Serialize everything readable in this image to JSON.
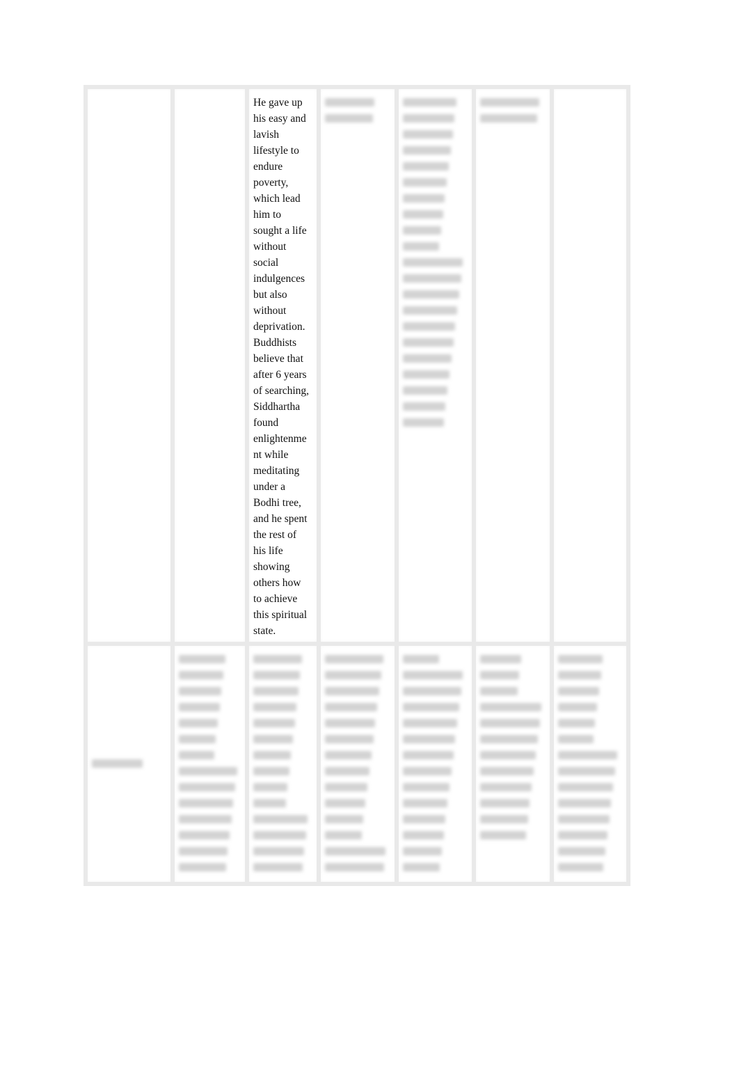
{
  "document": {
    "table": {
      "rows": [
        {
          "cells": [
            {
              "text": "",
              "blurred": false
            },
            {
              "text": "",
              "blurred": false
            },
            {
              "text": "He gave up\nhis easy and\nlavish\nlifestyle to\nendure\npoverty,\nwhich lead\nhim to\nsought a life\nwithout\nsocial\nindulgences\nbut also\nwithout\ndeprivation.\nBuddhists\nbelieve that\nafter 6 years\nof searching,\nSiddhartha\nfound\nenlightenme\nnt while\nmeditating\nunder a\nBodhi tree,\nand he spent\nthe rest of\nhis life\nshowing\nothers how\nto achieve\nthis spiritual\nstate.",
              "blurred": false
            },
            {
              "text": "[blurred]",
              "blurred": true,
              "lines": 2
            },
            {
              "text": "[blurred]",
              "blurred": true,
              "lines": 21
            },
            {
              "text": "[blurred]",
              "blurred": true,
              "lines": 2
            },
            {
              "text": "",
              "blurred": false
            }
          ]
        },
        {
          "cells": [
            {
              "text": "[blurred]",
              "blurred": true,
              "lines": 1
            },
            {
              "text": "[blurred]",
              "blurred": true,
              "lines": 14
            },
            {
              "text": "[blurred]",
              "blurred": true,
              "lines": 14
            },
            {
              "text": "[blurred]",
              "blurred": true,
              "lines": 14
            },
            {
              "text": "[blurred]",
              "blurred": true,
              "lines": 14
            },
            {
              "text": "[blurred]",
              "blurred": true,
              "lines": 12
            },
            {
              "text": "[blurred]",
              "blurred": true,
              "lines": 14
            }
          ]
        }
      ]
    }
  }
}
